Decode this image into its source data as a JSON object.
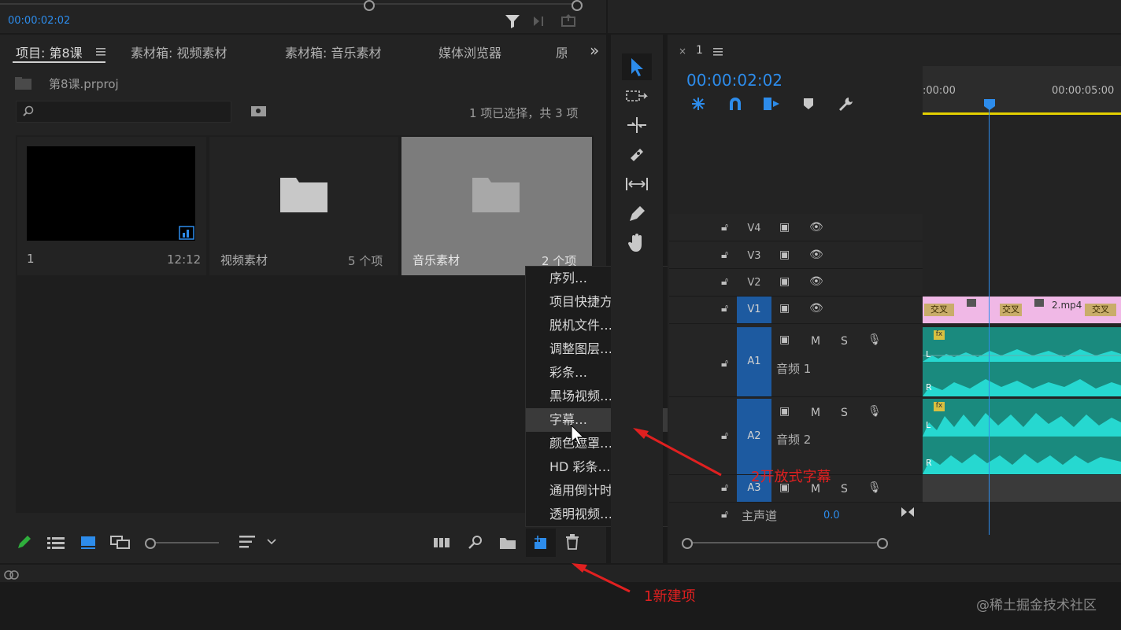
{
  "top": {
    "timecode": "00:00:02:02"
  },
  "project": {
    "tabs": [
      "项目: 第8课",
      "素材箱: 视频素材",
      "素材箱: 音乐素材",
      "媒体浏览器",
      "原"
    ],
    "menu_icon": "hamburger-icon",
    "overflow": "»",
    "file_name": "第8课.prproj",
    "search_placeholder": "",
    "selection_status": "1 项已选择，共 3 项",
    "items": [
      {
        "name": "1",
        "meta": "12:12"
      },
      {
        "name": "视频素材",
        "meta": "5 个项"
      },
      {
        "name": "音乐素材",
        "meta": "2 个项"
      }
    ]
  },
  "menu": {
    "items": [
      "序列…",
      "项目快捷方式…",
      "脱机文件…",
      "调整图层…",
      "彩条…",
      "黑场视频…",
      "字幕…",
      "颜色遮罩…",
      "HD 彩条…",
      "通用倒计时片头…",
      "透明视频…"
    ],
    "highlighted_index": 6
  },
  "timeline": {
    "sequence_name": "1",
    "timecode": "00:00:02:02",
    "ruler_labels": [
      ":00:00",
      "00:00:05:00"
    ],
    "video_tracks": [
      "V4",
      "V3",
      "V2",
      "V1"
    ],
    "audio_tracks": [
      {
        "id": "A1",
        "name": "音频 1"
      },
      {
        "id": "A2",
        "name": "音频 2"
      },
      {
        "id": "A3",
        "name": ""
      }
    ],
    "track_buttons": {
      "m": "M",
      "s": "S"
    },
    "master": {
      "label": "主声道",
      "value": "0.0"
    },
    "v1_clip_label": "2.mp4",
    "transition_label": "交叉",
    "fx_label": "fx",
    "channel_l": "L",
    "channel_r": "R"
  },
  "annotations": {
    "step1": "1新建项",
    "step2": "2开放式字幕"
  },
  "watermark": "@稀土掘金技术社区",
  "colors": {
    "accent": "#2d8ceb",
    "annotation": "#e02020",
    "audio_clip": "#1a8a7e"
  }
}
